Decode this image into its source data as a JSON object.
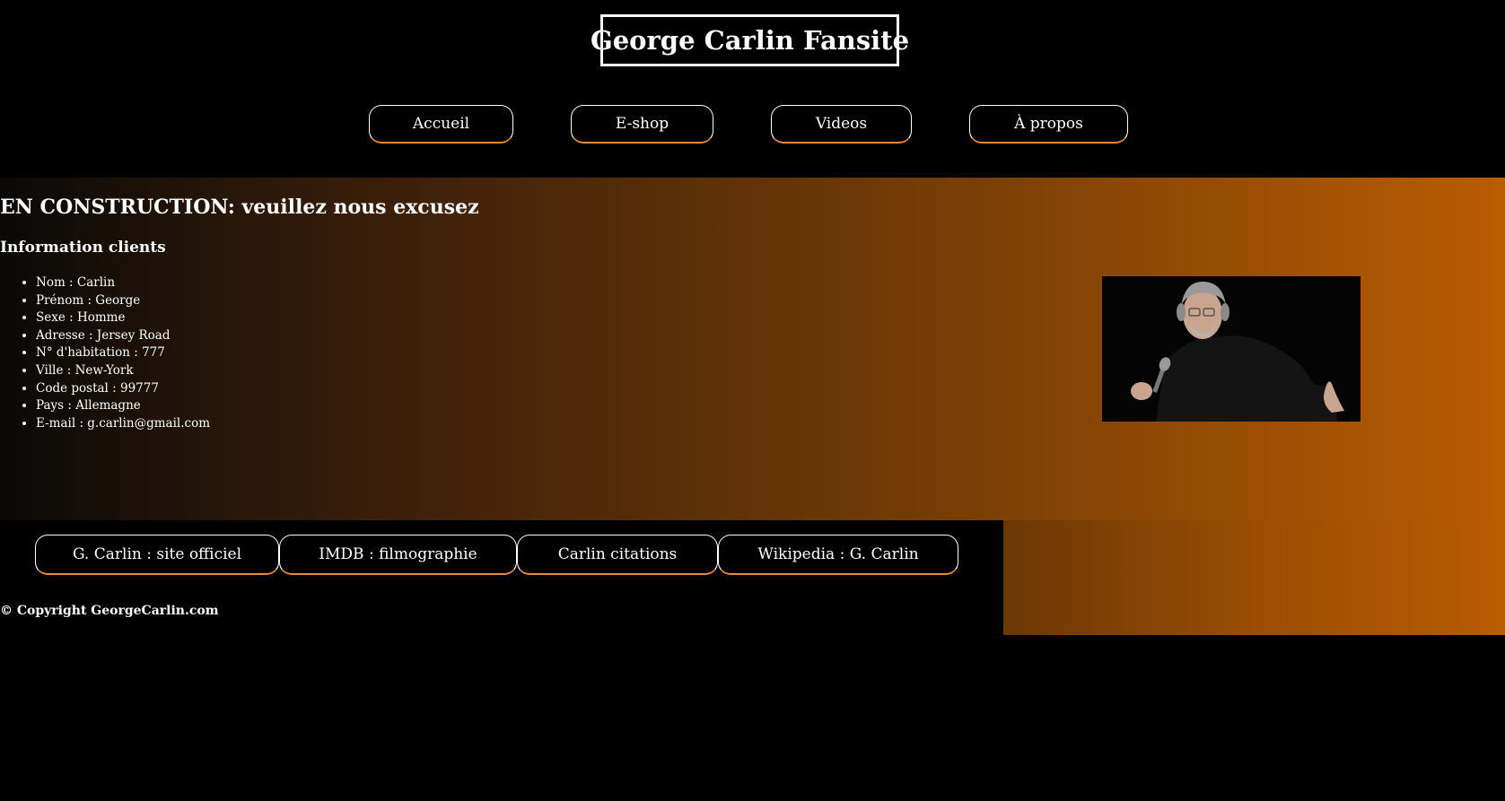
{
  "header": {
    "title": "George Carlin Fansite"
  },
  "nav": {
    "items": [
      {
        "label": "Accueil"
      },
      {
        "label": "E-shop"
      },
      {
        "label": "Videos"
      },
      {
        "label": "À propos"
      }
    ]
  },
  "main": {
    "notice": "EN CONSTRUCTION: veuillez nous excusez",
    "section_title": "Information clients",
    "info": [
      "Nom : Carlin",
      "Prénom : George",
      "Sexe : Homme",
      "Adresse : Jersey Road",
      "N° d'habitation : 777",
      "Ville : New-York",
      "Code postal : 99777",
      "Pays : Allemagne",
      "E-mail : g.carlin@gmail.com"
    ]
  },
  "footer": {
    "links": [
      {
        "label": "G. Carlin : site officiel"
      },
      {
        "label": "IMDB : filmographie"
      },
      {
        "label": "Carlin citations"
      },
      {
        "label": "Wikipedia : G. Carlin"
      }
    ],
    "copyright": "© Copyright GeorgeCarlin.com"
  },
  "colors": {
    "background": "#000000",
    "accent_orange": "#e98b3a",
    "gradient_end": "#b95c02"
  }
}
